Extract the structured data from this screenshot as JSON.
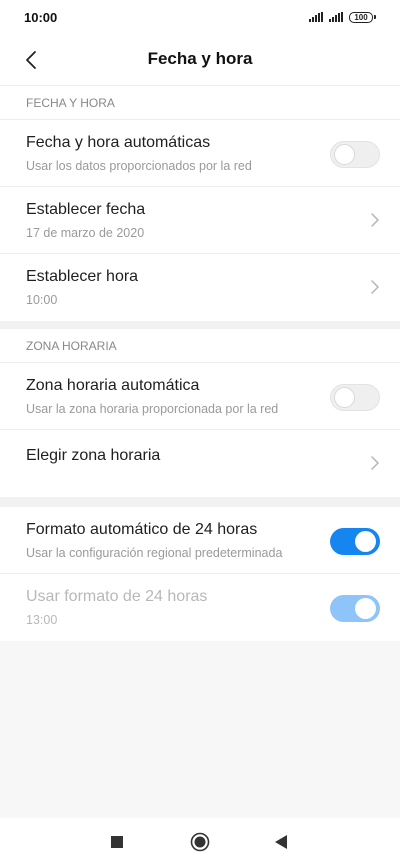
{
  "status_bar": {
    "time": "10:00",
    "battery": "100"
  },
  "header": {
    "title": "Fecha y hora"
  },
  "section_date_time": {
    "header": "FECHA Y HORA",
    "items": [
      {
        "title": "Fecha y hora automáticas",
        "subtitle": "Usar los datos proporcionados por la red",
        "control": "toggle",
        "state": "off"
      },
      {
        "title": "Establecer fecha",
        "subtitle": "17 de marzo de 2020",
        "control": "chevron"
      },
      {
        "title": "Establecer hora",
        "subtitle": "10:00",
        "control": "chevron"
      }
    ]
  },
  "section_time_zone": {
    "header": "ZONA HORARIA",
    "items": [
      {
        "title": "Zona horaria automática",
        "subtitle": "Usar la zona horaria proporcionada por la red",
        "control": "toggle",
        "state": "off"
      },
      {
        "title": "Elegir zona horaria",
        "control": "chevron"
      }
    ]
  },
  "section_format": {
    "items": [
      {
        "title": "Formato automático de 24 horas",
        "subtitle": "Usar la configuración regional predeterminada",
        "control": "toggle",
        "state": "on"
      },
      {
        "title": "Usar formato de 24 horas",
        "subtitle": "13:00",
        "control": "toggle",
        "state": "on",
        "disabled": true
      }
    ]
  },
  "colors": {
    "accent": "#1586f0",
    "accent_disabled": "#8ec4f7"
  },
  "nav_bar": {
    "icons": [
      "recents-square-icon",
      "home-circle-icon",
      "back-triangle-icon"
    ]
  }
}
